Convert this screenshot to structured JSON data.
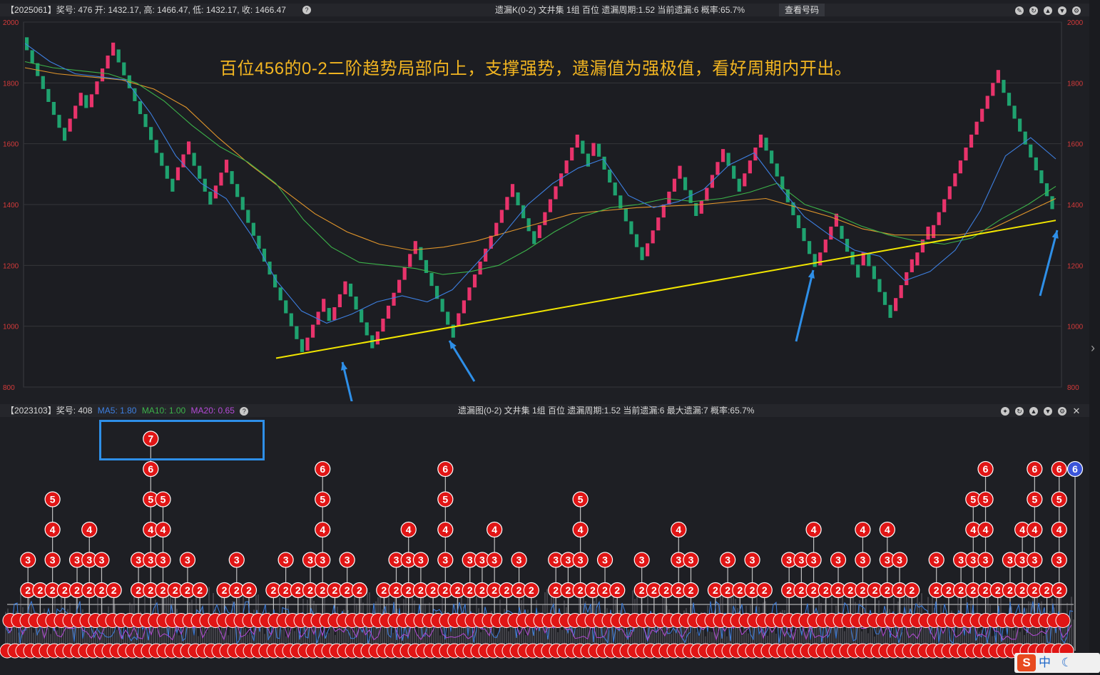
{
  "top_panel": {
    "info_left": "【2025061】奖号: 476  开: 1432.17, 高: 1466.47, 低: 1432.17, 收: 1466.47",
    "info_mid": "遗漏K(0-2)  文井集  1组  百位  遗漏周期:1.52  当前遗漏:6  概率:65.7%",
    "query_button": "查看号码",
    "y_ticks": [
      "2000",
      "1800",
      "1600",
      "1400",
      "1200",
      "1000",
      "800"
    ],
    "annotation": "百位456的0-2二阶趋势局部向上，支撑强势，遗漏值为强极值，看好周期内开出。",
    "colors": {
      "up": "#e8336b",
      "down": "#1fa26f",
      "ma_blue": "#3d7fe0",
      "ma_green": "#3cb34a",
      "ma_orange": "#e2962b",
      "trend": "#f2e600",
      "arrow": "#2e8fe8"
    }
  },
  "bottom_panel": {
    "info_left": "【2023103】奖号: 408",
    "ma5": "MA5: 1.80",
    "ma10": "MA10: 1.00",
    "ma20": "MA20: 0.65",
    "info_mid": "遗漏图(0-2)  文井集  1组  百位  遗漏周期:1.52  当前遗漏:6  最大遗漏:7  概率:65.7%",
    "colors": {
      "ma5": "#3d7fe0",
      "ma10": "#3cb34a",
      "ma20": "#b34ad6",
      "ball": "#e01515",
      "current": "#3b55d9"
    }
  },
  "ime": {
    "logo": "S",
    "text": "中"
  },
  "chart_data": {
    "type": "candlestick",
    "ylim": [
      800,
      2000
    ],
    "y_ticks": [
      800,
      1000,
      1200,
      1400,
      1600,
      1800,
      2000
    ],
    "segments": [
      {
        "from": 1950,
        "to": 1640
      },
      {
        "from": 1640,
        "to": 1760
      },
      {
        "from": 1760,
        "to": 1720
      },
      {
        "from": 1720,
        "to": 1910
      },
      {
        "from": 1910,
        "to": 1480
      },
      {
        "from": 1480,
        "to": 1570
      },
      {
        "from": 1570,
        "to": 1420
      },
      {
        "from": 1420,
        "to": 1510
      },
      {
        "from": 1510,
        "to": 920
      },
      {
        "from": 920,
        "to": 1060
      },
      {
        "from": 1060,
        "to": 1020
      },
      {
        "from": 1020,
        "to": 1140
      },
      {
        "from": 1140,
        "to": 940
      },
      {
        "from": 940,
        "to": 1260
      },
      {
        "from": 1260,
        "to": 1000
      },
      {
        "from": 1000,
        "to": 1440
      },
      {
        "from": 1440,
        "to": 1290
      },
      {
        "from": 1290,
        "to": 1610
      },
      {
        "from": 1610,
        "to": 1560
      },
      {
        "from": 1560,
        "to": 1600
      },
      {
        "from": 1600,
        "to": 1230
      },
      {
        "from": 1230,
        "to": 1490
      },
      {
        "from": 1490,
        "to": 1370
      },
      {
        "from": 1370,
        "to": 1570
      },
      {
        "from": 1570,
        "to": 1460
      },
      {
        "from": 1460,
        "to": 1620
      },
      {
        "from": 1620,
        "to": 1200
      },
      {
        "from": 1200,
        "to": 1330
      },
      {
        "from": 1330,
        "to": 1200
      },
      {
        "from": 1200,
        "to": 1240
      },
      {
        "from": 1240,
        "to": 1050
      },
      {
        "from": 1050,
        "to": 1200
      },
      {
        "from": 1200,
        "to": 1290
      },
      {
        "from": 1290,
        "to": 1810
      },
      {
        "from": 1810,
        "to": 1400
      }
    ],
    "ma_blue": [
      1930,
      1870,
      1830,
      1820,
      1810,
      1700,
      1560,
      1470,
      1420,
      1300,
      1150,
      1050,
      1010,
      1040,
      1080,
      1100,
      1080,
      1120,
      1210,
      1300,
      1400,
      1470,
      1520,
      1550,
      1430,
      1390,
      1410,
      1450,
      1530,
      1570,
      1460,
      1360,
      1300,
      1250,
      1230,
      1150,
      1180,
      1250,
      1380,
      1560,
      1620,
      1550
    ],
    "ma_green": [
      1870,
      1850,
      1840,
      1830,
      1800,
      1740,
      1660,
      1590,
      1540,
      1470,
      1350,
      1260,
      1210,
      1200,
      1190,
      1170,
      1180,
      1200,
      1250,
      1310,
      1360,
      1390,
      1400,
      1420,
      1410,
      1420,
      1440,
      1470,
      1400,
      1370,
      1330,
      1300,
      1280,
      1270,
      1290,
      1350,
      1400,
      1460
    ],
    "ma_orange": [
      1850,
      1830,
      1820,
      1810,
      1780,
      1720,
      1620,
      1530,
      1450,
      1370,
      1310,
      1270,
      1250,
      1260,
      1280,
      1310,
      1340,
      1370,
      1380,
      1390,
      1395,
      1400,
      1410,
      1420,
      1390,
      1360,
      1320,
      1300,
      1300,
      1300,
      1320,
      1370,
      1420
    ],
    "trendline": {
      "from": {
        "x_frac": 0.0,
        "value": 895
      },
      "to": {
        "x_frac": 1.0,
        "value": 1348
      }
    },
    "sub_values": [
      1,
      3,
      2,
      5,
      2,
      3,
      4,
      3,
      2,
      1,
      3,
      7,
      5,
      2,
      3,
      2,
      1,
      2,
      3,
      2,
      1,
      2,
      3,
      2,
      3,
      6,
      2,
      3,
      2,
      1,
      2,
      3,
      4,
      3,
      2,
      6,
      2,
      3,
      3,
      4,
      2,
      3,
      2,
      1,
      3,
      3,
      5,
      2,
      3,
      2,
      1,
      3,
      2,
      2,
      4,
      3,
      1,
      2,
      3,
      2,
      3,
      2,
      1,
      3,
      3,
      4,
      2,
      3,
      2,
      4,
      2,
      4,
      3,
      2,
      1,
      3,
      2,
      3,
      5,
      6,
      2,
      3,
      4,
      6,
      2,
      6
    ]
  }
}
